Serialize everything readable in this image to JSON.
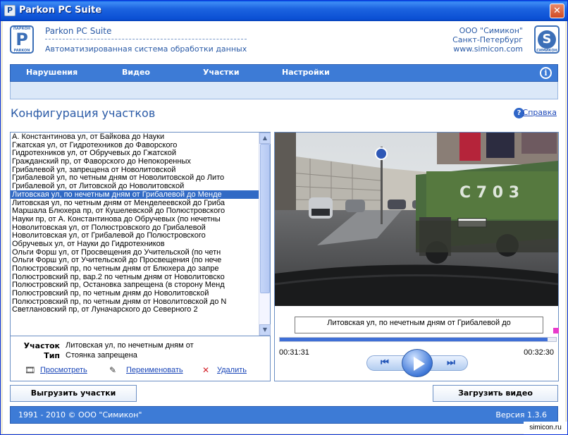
{
  "window": {
    "title": "Parkon PC Suite",
    "icon_letter": "P",
    "close_glyph": "✕"
  },
  "header": {
    "app_name": "Parkon PC Suite",
    "subtitle": "Автоматизированная система обработки данных",
    "company": "ООО \"Симикон\"",
    "city": "Санкт-Петербург",
    "website": "www.simicon.com",
    "logo_left_letter": "P",
    "logo_left_top": "ПАРКОН",
    "logo_left_bottom": "PARKON",
    "logo_right_letter": "S",
    "logo_right_text": "СИМИКОН"
  },
  "nav": {
    "items": [
      {
        "label": "Нарушения"
      },
      {
        "label": "Видео"
      },
      {
        "label": "Участки"
      },
      {
        "label": "Настройки"
      }
    ],
    "info_glyph": "i"
  },
  "page": {
    "title": "Конфигурация участков",
    "help_label": "Справка",
    "help_glyph": "?"
  },
  "sections": {
    "selected_index": 8,
    "items": [
      "А. Константинова ул, от Байкова до Науки",
      "Гжатская ул, от Гидротехников до Фаворского",
      "Гидротехников ул, от Обручевых до Гжатской",
      "Гражданский пр, от Фаворского до Непокоренных",
      "Грибалевой  ул, запрещена от Новолитовской",
      "Грибалевой  ул, по четным дням от Новолитовской до Лито",
      "Грибалевой ул, от Литовской до Новолитовской",
      "Литовская ул, по нечетным дням от Грибалевой до Менде",
      "Литовская ул, по четным дням от Менделеевской до Гриба",
      "Маршала Блюхера пр, от Кушелевской до Полюстровского",
      "Науки пр, от А. Константинова до Обручевых (по нечетны",
      "Новолитовская  ул, от Полюстровского до Грибалевой",
      "Новолитовская  ул, от Грибалевой до Полюстровского",
      "Обручевых  ул, от Науки до Гидротехников",
      "Ольги Форш  ул, от Просвещения до Учительской (по четн",
      "Ольги Форш  ул, от Учительской до Просвещения (по нече",
      "Полюстровский  пр, по четным дням от Блюхера до запре",
      "Полюстровский пр, вар.2 по четным дням от Новолитовско",
      "Полюстровский пр, Остановка запрещена (в сторону Менд",
      "Полюстровский пр, по четным дням до Новолитовской",
      "Полюстровский пр, по четным дням от Новолитовской до N",
      "Светлановский пр, от Луначарского до Северного 2"
    ]
  },
  "details": {
    "section_label": "Участок",
    "section_value": "Литовская ул, по нечетным дням от",
    "type_label": "Тип",
    "type_value": "Стоянка запрещена"
  },
  "actions": {
    "view": "Просмотреть",
    "rename": "Переименовать",
    "delete": "Удалить",
    "delete_glyph": "✕"
  },
  "player": {
    "caption": "Литовская ул, по нечетным дням от Грибалевой до",
    "current_time": "00:31:31",
    "total_time": "00:32:30",
    "progress": 0.97,
    "prev_glyph": "⏮",
    "next_glyph": "⏭"
  },
  "buttons": {
    "export": "Выгрузить участки",
    "load_video": "Загрузить видео"
  },
  "footer": {
    "copyright": "1991 - 2010 © ООО \"Симикон\"",
    "version": "Версия 1.3.6"
  },
  "watermark": "simicon.ru",
  "colors": {
    "accent": "#3d7bd6",
    "selection": "#316ac5",
    "link": "#1a46b8"
  }
}
